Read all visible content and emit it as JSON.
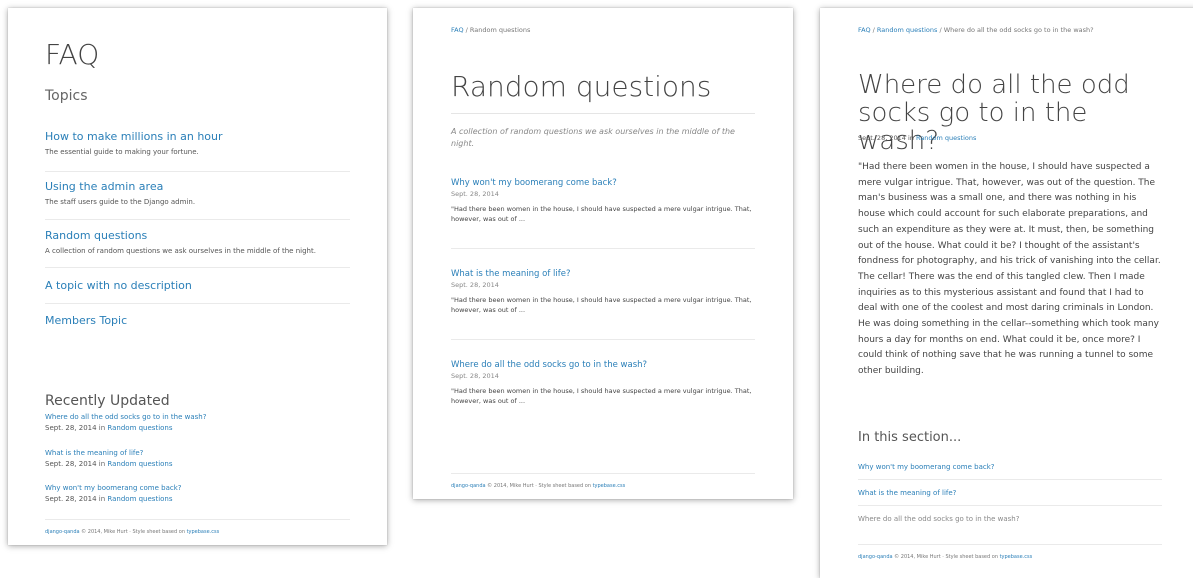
{
  "card1": {
    "title": "FAQ",
    "topics_title": "Topics",
    "topics": [
      {
        "title": "How to make millions in an hour",
        "desc": "The essential guide to making your fortune."
      },
      {
        "title": "Using the admin area",
        "desc": "The staff users guide to the Django admin."
      },
      {
        "title": "Random questions",
        "desc": "A collection of random questions we ask ourselves in the middle of the night."
      },
      {
        "title": "A topic with no description",
        "desc": ""
      },
      {
        "title": "Members Topic",
        "desc": ""
      }
    ],
    "recent_title": "Recently Updated",
    "recent": [
      {
        "title": "Where do all the odd socks go to in the wash?",
        "date": "Sept. 28, 2014",
        "in": " in ",
        "topic": "Random questions"
      },
      {
        "title": "What is the meaning of life?",
        "date": "Sept. 28, 2014",
        "in": " in ",
        "topic": "Random questions"
      },
      {
        "title": "Why won't my boomerang come back?",
        "date": "Sept. 28, 2014",
        "in": " in ",
        "topic": "Random questions"
      }
    ],
    "footer": {
      "brand": "django-qanda",
      "text": " © 2014, Mike Hurt · Style sheet based on ",
      "css": "typebase.css"
    }
  },
  "card2": {
    "breadcrumb": {
      "home": "FAQ",
      "sep": " / ",
      "current": "Random questions"
    },
    "title": "Random questions",
    "subtitle": "A collection of random questions we ask ourselves in the middle of the night.",
    "questions": [
      {
        "title": "Why won't my boomerang come back?",
        "date": "Sept. 28, 2014",
        "excerpt": "\"Had there been women in the house, I should have suspected a mere vulgar intrigue. That, however, was out of ..."
      },
      {
        "title": "What is the meaning of life?",
        "date": "Sept. 28, 2014",
        "excerpt": "\"Had there been women in the house, I should have suspected a mere vulgar intrigue. That, however, was out of ..."
      },
      {
        "title": "Where do all the odd socks go to in the wash?",
        "date": "Sept. 28, 2014",
        "excerpt": "\"Had there been women in the house, I should have suspected a mere vulgar intrigue. That, however, was out of ..."
      }
    ],
    "footer": {
      "brand": "django-qanda",
      "text": " © 2014, Mike Hurt · Style sheet based on ",
      "css": "typebase.css"
    }
  },
  "card3": {
    "breadcrumb": {
      "home": "FAQ",
      "sep": " / ",
      "topic": "Random questions",
      "current": "Where do all the odd socks go to in the wash?"
    },
    "title": "Where do all the odd socks go to in the wash?",
    "meta": {
      "date": "Sept. 28, 2014",
      "in": " in ",
      "topic": "Random questions"
    },
    "body": "\"Had there been women in the house, I should have suspected a mere vulgar intrigue. That, however, was out of the question. The man's business was a small one, and there was nothing in his house which could account for such elaborate preparations, and such an expenditure as they were at. It must, then, be something out of the house. What could it be? I thought of the assistant's fondness for photography, and his trick of vanishing into the cellar. The cellar! There was the end of this tangled clew. Then I made inquiries as to this mysterious assistant and found that I had to deal with one of the coolest and most daring criminals in London. He was doing something in the cellar--something which took many hours a day for months on end. What could it be, once more? I could think of nothing save that he was running a tunnel to some other building.",
    "section_title": "In this section...",
    "section_items": [
      {
        "label": "Why won't my boomerang come back?",
        "active": true
      },
      {
        "label": "What is the meaning of life?",
        "active": true
      },
      {
        "label": "Where do all the odd socks go to in the wash?",
        "active": false
      }
    ],
    "footer": {
      "brand": "django-qanda",
      "text": " © 2014, Mike Hurt · Style sheet based on ",
      "css": "typebase.css"
    }
  }
}
